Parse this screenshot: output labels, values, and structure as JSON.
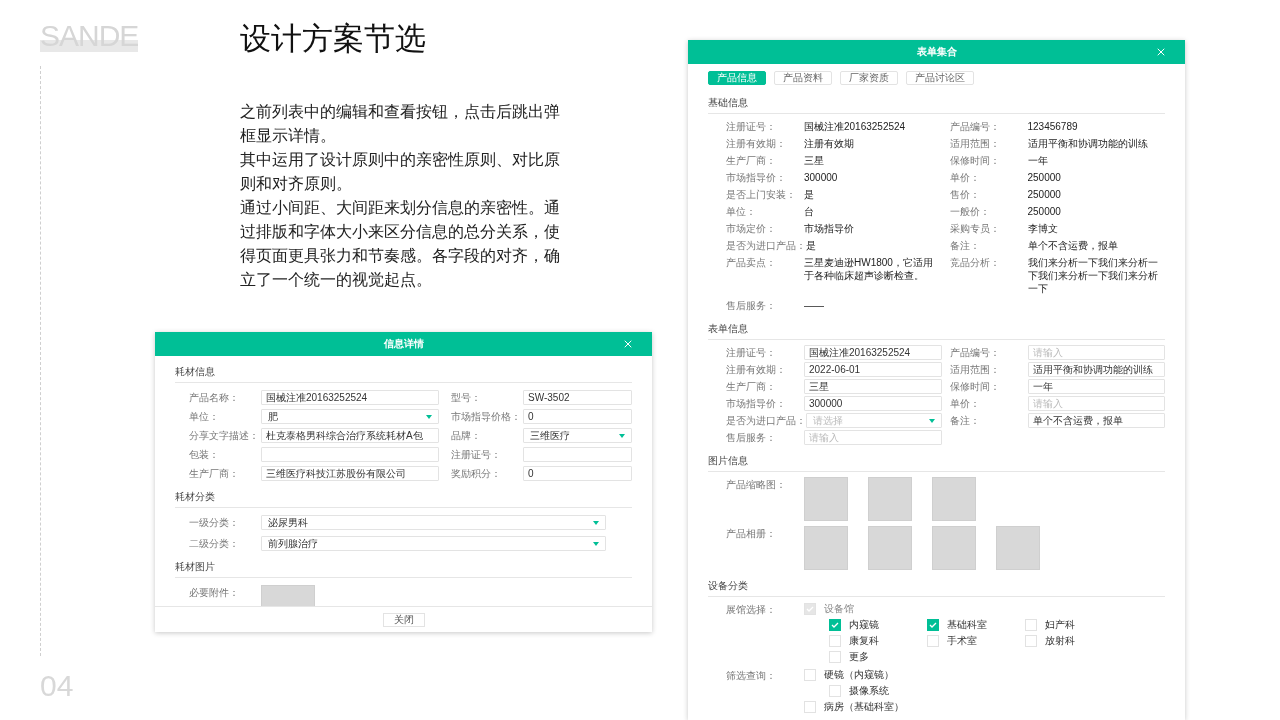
{
  "brand": "SANDE",
  "page_number": "04",
  "title": "设计方案节选",
  "paragraphs": [
    "之前列表中的编辑和查看按钮，点击后跳出弹框显示详情。",
    "其中运用了设计原则中的亲密性原则、对比原则和对齐原则。",
    "通过小间距、大间距来划分信息的亲密性。通过排版和字体大小来区分信息的总分关系，使得页面更具张力和节奏感。各字段的对齐，确立了一个统一的视觉起点。"
  ],
  "detail_dialog": {
    "title": "信息详情",
    "sections": [
      {
        "title": "耗材信息",
        "fields": [
          {
            "kind": "input",
            "label": "产品名称：",
            "value": "国械注准20163252524"
          },
          {
            "kind": "input",
            "label": "型号：",
            "value": "SW-3502"
          },
          {
            "kind": "select",
            "label": "单位：",
            "value": "肥"
          },
          {
            "kind": "input",
            "label": "市场指导价格：",
            "value": "0"
          },
          {
            "kind": "input",
            "label": "分享文字描述：",
            "value": "杜克泰格男科综合治疗系统耗材A包"
          },
          {
            "kind": "select",
            "label": "品牌：",
            "value": "三维医疗"
          },
          {
            "kind": "input",
            "label": "包装："
          },
          {
            "kind": "input",
            "label": "注册证号："
          },
          {
            "kind": "input",
            "label": "生产厂商：",
            "value": "三维医疗科技江苏股份有限公司"
          },
          {
            "kind": "input",
            "label": "奖励积分：",
            "value": "0"
          }
        ]
      },
      {
        "title": "耗材分类",
        "rows": [
          {
            "kind": "select",
            "label": "一级分类：",
            "value": "泌尿男科"
          },
          {
            "kind": "select",
            "label": "二级分类：",
            "value": "前列腺治疗"
          }
        ]
      },
      {
        "title": "耗材图片",
        "rows": [
          {
            "kind": "images",
            "label": "必要附件：",
            "slots": [
              {
                "kind": "placeholder"
              }
            ]
          }
        ]
      }
    ],
    "footer_button": "关闭"
  },
  "form_dialog": {
    "title": "表单集合",
    "tabs": [
      {
        "label": "产品信息",
        "selected": true
      },
      {
        "label": "产品资料",
        "selected": false
      },
      {
        "label": "厂家资质",
        "selected": false
      },
      {
        "label": "产品讨论区",
        "selected": false
      }
    ],
    "sections": [
      {
        "title": "基础信息",
        "fields": [
          {
            "kind": "text",
            "label": "注册证号：",
            "value": "国械注准20163252524"
          },
          {
            "kind": "text",
            "label": "产品编号：",
            "value": "123456789"
          },
          {
            "kind": "text",
            "label": "注册有效期：",
            "value": "注册有效期"
          },
          {
            "kind": "text",
            "label": "适用范围：",
            "value": "适用平衡和协调功能的训练"
          },
          {
            "kind": "text",
            "label": "生产厂商：",
            "value": "三星"
          },
          {
            "kind": "text",
            "label": "保修时间：",
            "value": "一年"
          },
          {
            "kind": "text",
            "label": "市场指导价：",
            "value": "300000"
          },
          {
            "kind": "text",
            "label": "单价：",
            "value": "250000"
          },
          {
            "kind": "text",
            "label": "是否上门安装：",
            "value": "是"
          },
          {
            "kind": "text",
            "label": "售价：",
            "value": "250000"
          },
          {
            "kind": "text",
            "label": "单位：",
            "value": "台"
          },
          {
            "kind": "text",
            "label": "一般价：",
            "value": "250000"
          },
          {
            "kind": "text",
            "label": "市场定价：",
            "value": "市场指导价"
          },
          {
            "kind": "text",
            "label": "采购专员：",
            "value": "李博文"
          },
          {
            "kind": "text",
            "label": "是否为进口产品：",
            "value": "是"
          },
          {
            "kind": "text",
            "label": "备注：",
            "value": "单个不含运费，报单"
          },
          {
            "kind": "text",
            "label": "产品卖点：",
            "value": "三星麦迪逊HW1800，它适用于各种临床超声诊断检查。"
          },
          {
            "kind": "text",
            "label": "竞品分析：",
            "value": "我们来分析一下我们来分析一下我们来分析一下我们来分析一下"
          },
          {
            "kind": "text",
            "label": "售后服务：",
            "value": "——"
          }
        ]
      },
      {
        "title": "表单信息",
        "fields": [
          {
            "kind": "input",
            "label": "注册证号：",
            "value": "国械注准20163252524"
          },
          {
            "kind": "input",
            "label": "产品编号：",
            "placeholder": "请输入"
          },
          {
            "kind": "input",
            "label": "注册有效期：",
            "value": "2022-06-01"
          },
          {
            "kind": "input",
            "label": "适用范围：",
            "value": "适用平衡和协调功能的训练"
          },
          {
            "kind": "input",
            "label": "生产厂商：",
            "value": "三星"
          },
          {
            "kind": "input",
            "label": "保修时间：",
            "value": "一年"
          },
          {
            "kind": "input",
            "label": "市场指导价：",
            "value": "300000"
          },
          {
            "kind": "input",
            "label": "单价：",
            "placeholder": "请输入"
          },
          {
            "kind": "select",
            "label": "是否为进口产品：",
            "placeholder": "请选择"
          },
          {
            "kind": "input",
            "label": "备注：",
            "value": "单个不含运费，报单"
          },
          {
            "kind": "input",
            "label": "售后服务：",
            "placeholder": "请输入"
          }
        ]
      },
      {
        "title": "图片信息",
        "rows": [
          {
            "kind": "images",
            "label": "产品缩略图：",
            "slots": [
              {
                "kind": "placeholder"
              },
              {
                "kind": "placeholder"
              },
              {
                "kind": "placeholder"
              }
            ]
          },
          {
            "kind": "images",
            "label": "产品相册：",
            "slots": [
              {
                "kind": "placeholder"
              },
              {
                "kind": "placeholder"
              },
              {
                "kind": "placeholder"
              },
              {
                "kind": "placeholder"
              }
            ]
          }
        ]
      },
      {
        "title": "设备分类",
        "rows": [
          {
            "kind": "checks",
            "label": "展馆选择：",
            "options": [
              {
                "label": "设备馆",
                "checked": true,
                "disabled": true,
                "children": [
                  {
                    "label": "内窥镜",
                    "checked": true
                  },
                  {
                    "label": "基础科室",
                    "checked": true
                  },
                  {
                    "label": "妇产科",
                    "checked": false
                  },
                  {
                    "label": "康复科",
                    "checked": false
                  },
                  {
                    "label": "手术室",
                    "checked": false
                  },
                  {
                    "label": "放射科",
                    "checked": false
                  },
                  {
                    "label": "更多",
                    "checked": false
                  }
                ]
              }
            ]
          },
          {
            "kind": "checks",
            "label": "筛选查询：",
            "options": [
              {
                "label": "硬镜（内窥镜）",
                "checked": false,
                "disabled": false,
                "children": [
                  {
                    "label": "摄像系统",
                    "checked": false
                  }
                ]
              },
              {
                "label": "病房（基础科室）",
                "checked": false,
                "disabled": false
              }
            ]
          }
        ]
      }
    ]
  }
}
